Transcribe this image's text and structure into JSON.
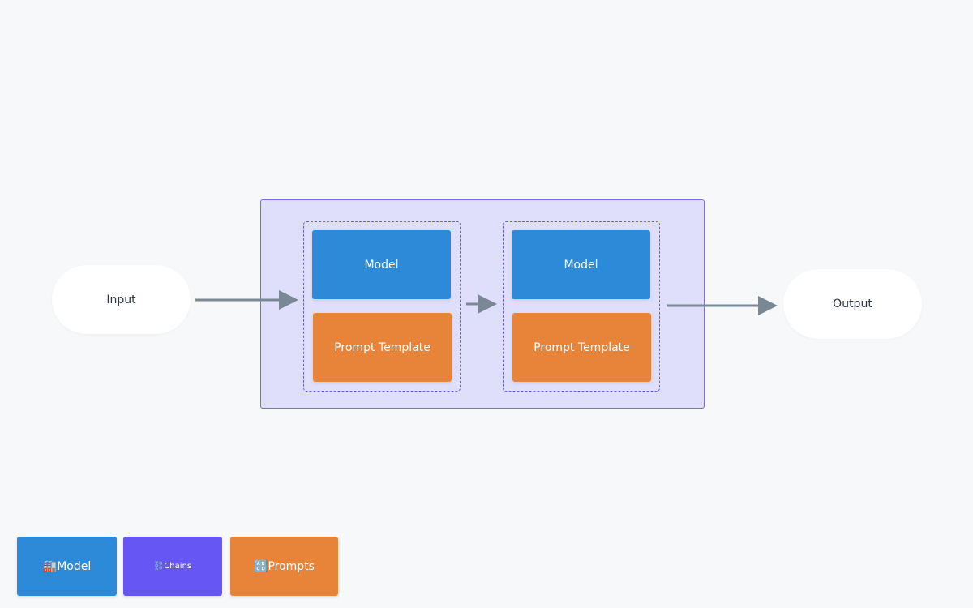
{
  "nodes": {
    "input": "Input",
    "output": "Output",
    "chain1": {
      "model": "Model",
      "prompt": "Prompt Template"
    },
    "chain2": {
      "model": "Model",
      "prompt": "Prompt Template"
    }
  },
  "legend": [
    {
      "icon": "🏭",
      "label": "Model",
      "color": "#2d8ad9"
    },
    {
      "icon": "⛓️",
      "label": "Chains",
      "color": "#6657f5"
    },
    {
      "icon": "🔠",
      "label": "Prompts",
      "color": "#e8843a"
    }
  ],
  "colors": {
    "model": "#2d8ad9",
    "prompt": "#e8843a",
    "chain": "#6657f5",
    "arrow": "#7a8794"
  }
}
